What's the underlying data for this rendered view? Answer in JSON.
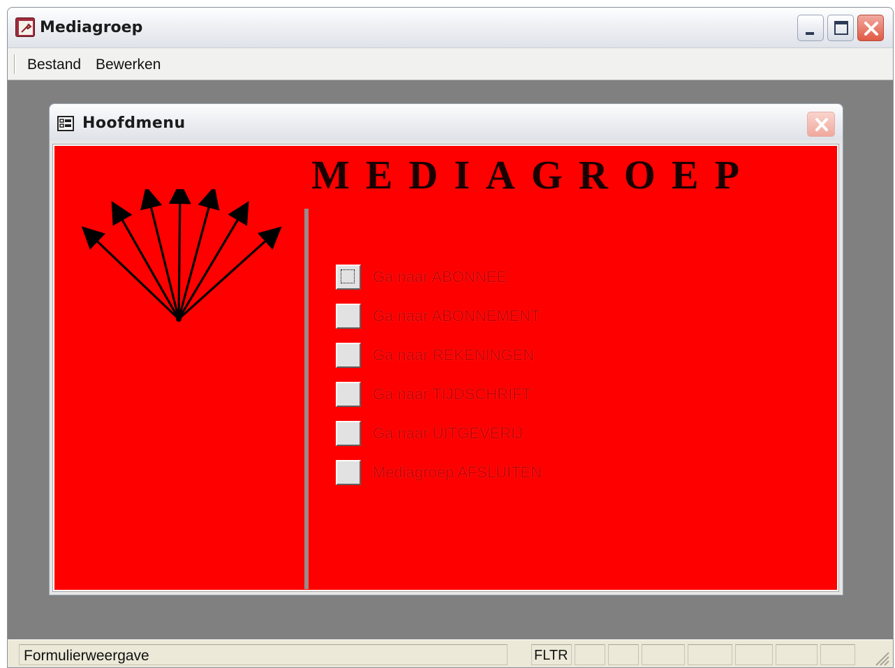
{
  "app": {
    "title": "Mediagroep",
    "menu": [
      "Bestand",
      "Bewerken"
    ]
  },
  "form": {
    "title": "Hoofdmenu",
    "heading": "MEDIAGROEP",
    "background_color": "#ff0000",
    "items": [
      {
        "label": "Ga naar ABONNEE",
        "focused": true
      },
      {
        "label": "Ga naar ABONNEMENT",
        "focused": false
      },
      {
        "label": "Ga naar REKENINGEN",
        "focused": false
      },
      {
        "label": "Ga naar TIJDSCHRIFT",
        "focused": false
      },
      {
        "label": "Ga naar UITGEVERIJ",
        "focused": false
      },
      {
        "label": "Mediagroep AFSLUITEN",
        "focused": false
      }
    ]
  },
  "status": {
    "mode": "Formulierweergave",
    "indicator": "FLTR"
  }
}
